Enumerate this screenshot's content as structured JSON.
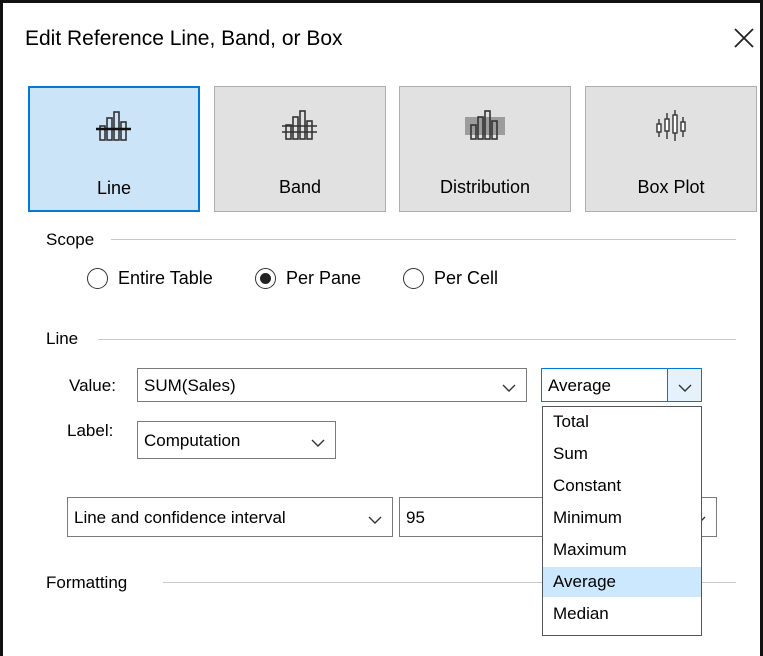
{
  "dialog": {
    "title": "Edit Reference Line, Band, or Box"
  },
  "types": [
    {
      "label": "Line",
      "selected": true,
      "icon": "line-chart-icon"
    },
    {
      "label": "Band",
      "selected": false,
      "icon": "band-chart-icon"
    },
    {
      "label": "Distribution",
      "selected": false,
      "icon": "distribution-chart-icon"
    },
    {
      "label": "Box Plot",
      "selected": false,
      "icon": "box-plot-icon"
    }
  ],
  "scope": {
    "heading": "Scope",
    "options": [
      {
        "label": "Entire Table",
        "checked": false
      },
      {
        "label": "Per Pane",
        "checked": true
      },
      {
        "label": "Per Cell",
        "checked": false
      }
    ]
  },
  "line": {
    "heading": "Line",
    "value_label": "Value:",
    "value_field": "SUM(Sales)",
    "aggregation": "Average",
    "label_label": "Label:",
    "label_value": "Computation",
    "interval_mode": "Line and confidence interval",
    "confidence": "95"
  },
  "aggregation_options": [
    "Total",
    "Sum",
    "Constant",
    "Minimum",
    "Maximum",
    "Average",
    "Median"
  ],
  "aggregation_selected": "Average",
  "formatting": {
    "heading": "Formatting"
  },
  "colors": {
    "accent": "#0078d7",
    "selected_bg": "#cce4f7",
    "hover_bg": "#cce8ff"
  }
}
